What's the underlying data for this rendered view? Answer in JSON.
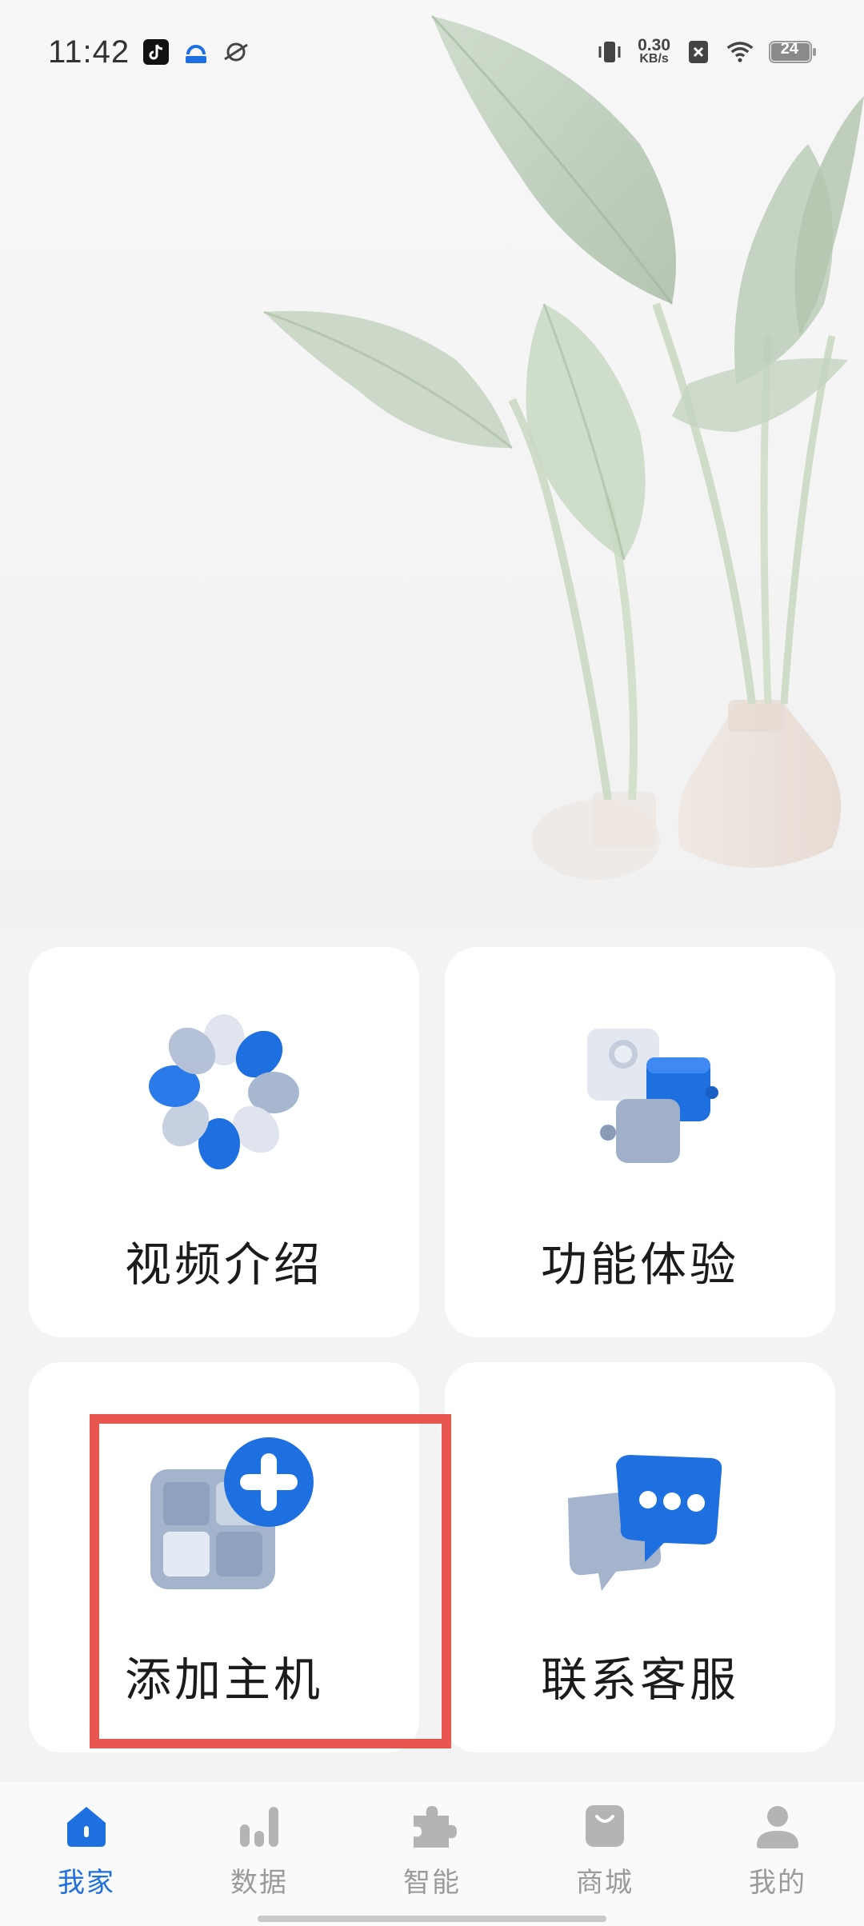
{
  "status_bar": {
    "time": "11:42",
    "net_speed_value": "0.30",
    "net_speed_unit": "KB/s",
    "battery": "24",
    "icons": [
      "tiktok-icon",
      "app-badge-icon",
      "planet-icon",
      "vibrate-icon",
      "sim-off-icon",
      "wifi-icon",
      "battery-icon"
    ]
  },
  "cards": {
    "video_intro": {
      "label": "视频介绍",
      "icon": "loading-ring-icon"
    },
    "feature_experience": {
      "label": "功能体验",
      "icon": "cubes-icon"
    },
    "add_host": {
      "label": "添加主机",
      "icon": "grid-plus-icon"
    },
    "contact_service": {
      "label": "联系客服",
      "icon": "chat-bubble-icon"
    }
  },
  "bottom_nav": {
    "items": [
      {
        "label": "我家",
        "icon": "home-icon",
        "active": true
      },
      {
        "label": "数据",
        "icon": "bar-chart-icon",
        "active": false
      },
      {
        "label": "智能",
        "icon": "puzzle-icon",
        "active": false
      },
      {
        "label": "商城",
        "icon": "shopping-bag-icon",
        "active": false
      },
      {
        "label": "我的",
        "icon": "user-icon",
        "active": false
      }
    ]
  },
  "colors": {
    "accent": "#1e6fe0",
    "highlight": "#e8574f",
    "inactive": "#9a9a9a"
  }
}
